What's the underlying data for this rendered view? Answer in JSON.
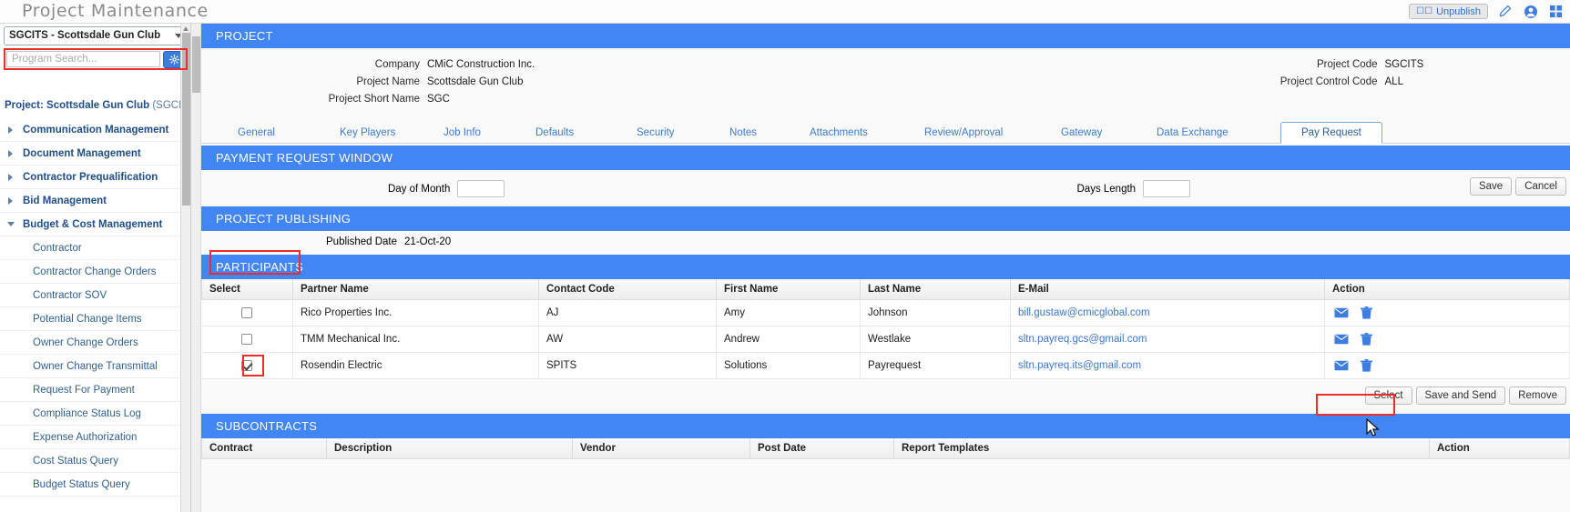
{
  "header": {
    "title": "Project Maintenance",
    "unpublish_label": "Unpublish",
    "icons": [
      "window-icon",
      "edit-icon",
      "user-icon",
      "grid-icon"
    ]
  },
  "sidebar": {
    "project_selector": "SGCITS - Scottsdale Gun Club",
    "search_placeholder": "Program Search...",
    "search_value": "",
    "gear_icon": "gear-icon",
    "project_line_label": "Project:",
    "project_line_name": "Scottsdale Gun Club",
    "project_line_code": "(SGCITS)",
    "items": [
      {
        "label": "Communication Management",
        "level": 1,
        "expanded": false
      },
      {
        "label": "Document Management",
        "level": 1,
        "expanded": false
      },
      {
        "label": "Contractor Prequalification",
        "level": 1,
        "expanded": false
      },
      {
        "label": "Bid Management",
        "level": 1,
        "expanded": false
      },
      {
        "label": "Budget & Cost Management",
        "level": 1,
        "expanded": true
      },
      {
        "label": "Contractor",
        "level": 2
      },
      {
        "label": "Contractor Change Orders",
        "level": 2
      },
      {
        "label": "Contractor SOV",
        "level": 2
      },
      {
        "label": "Potential Change Items",
        "level": 2
      },
      {
        "label": "Owner Change Orders",
        "level": 2
      },
      {
        "label": "Owner Change Transmittal",
        "level": 2
      },
      {
        "label": "Request For Payment",
        "level": 2
      },
      {
        "label": "Compliance Status Log",
        "level": 2
      },
      {
        "label": "Expense Authorization",
        "level": 2
      },
      {
        "label": "Cost Status Query",
        "level": 2
      },
      {
        "label": "Budget Status Query",
        "level": 2
      }
    ]
  },
  "project_panel": {
    "band_title": "PROJECT",
    "left_fields": [
      {
        "label": "Company",
        "value": "CMiC Construction Inc."
      },
      {
        "label": "Project Name",
        "value": "Scottsdale Gun Club"
      },
      {
        "label": "Project Short Name",
        "value": "SGC"
      }
    ],
    "right_fields": [
      {
        "label": "Project Code",
        "value": "SGCITS"
      },
      {
        "label": "Project Control Code",
        "value": "ALL"
      }
    ]
  },
  "tabs": {
    "items": [
      {
        "label": "General",
        "active": false
      },
      {
        "label": "Key Players",
        "active": false
      },
      {
        "label": "Job Info",
        "active": false
      },
      {
        "label": "Defaults",
        "active": false
      },
      {
        "label": "Security",
        "active": false
      },
      {
        "label": "Notes",
        "active": false
      },
      {
        "label": "Attachments",
        "active": false
      },
      {
        "label": "Review/Approval",
        "active": false
      },
      {
        "label": "Gateway",
        "active": false
      },
      {
        "label": "Data Exchange",
        "active": false
      },
      {
        "label": "Pay Request",
        "active": true
      }
    ]
  },
  "payment_request_window": {
    "band_title": "PAYMENT REQUEST WINDOW",
    "day_of_month_label": "Day of Month",
    "day_of_month_value": "",
    "days_length_label": "Days Length",
    "days_length_value": "",
    "save_label": "Save",
    "cancel_label": "Cancel"
  },
  "project_publishing": {
    "band_title": "PROJECT PUBLISHING",
    "published_date_label": "Published Date",
    "published_date_value": "21-Oct-20"
  },
  "participants": {
    "band_title": "PARTICIPANTS",
    "columns": [
      "Select",
      "Partner Name",
      "Contact Code",
      "First Name",
      "Last Name",
      "E-Mail",
      "Action"
    ],
    "rows": [
      {
        "selected": false,
        "partner_name": "Rico Properties Inc.",
        "contact_code": "AJ",
        "first_name": "Amy",
        "last_name": "Johnson",
        "email": "bill.gustaw@cmicglobal.com"
      },
      {
        "selected": false,
        "partner_name": "TMM Mechanical Inc.",
        "contact_code": "AW",
        "first_name": "Andrew",
        "last_name": "Westlake",
        "email": "sltn.payreq.gcs@gmail.com"
      },
      {
        "selected": true,
        "partner_name": "Rosendin Electric",
        "contact_code": "SPITS",
        "first_name": "Solutions",
        "last_name": "Payrequest",
        "email": "sltn.payreq.its@gmail.com"
      }
    ],
    "row_action_icons": [
      "envelope-icon",
      "trash-icon"
    ],
    "footer_buttons": [
      {
        "label": "Select",
        "highlighted": false
      },
      {
        "label": "Save and Send",
        "highlighted": true
      },
      {
        "label": "Remove",
        "highlighted": false
      }
    ]
  },
  "subcontracts": {
    "band_title": "SUBCONTRACTS",
    "columns": [
      "Contract",
      "Description",
      "Vendor",
      "Post Date",
      "Report Templates",
      "Action"
    ]
  }
}
